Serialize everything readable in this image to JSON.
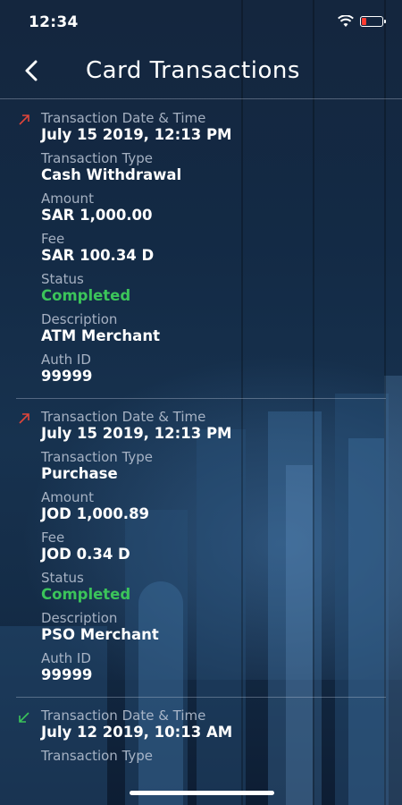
{
  "status": {
    "time": "12:34"
  },
  "header": {
    "title": "Card Transactions"
  },
  "labels": {
    "date": "Transaction Date & Time",
    "type": "Transaction Type",
    "amount": "Amount",
    "fee": "Fee",
    "status": "Status",
    "description": "Description",
    "auth": "Auth ID"
  },
  "transactions": [
    {
      "direction": "outgoing",
      "date": "July 15 2019, 12:13 PM",
      "type": "Cash Withdrawal",
      "amount": "SAR 1,000.00",
      "fee": "SAR 100.34 D",
      "status": "Completed",
      "description": "ATM Merchant",
      "auth": "99999"
    },
    {
      "direction": "outgoing",
      "date": "July 15 2019, 12:13 PM",
      "type": "Purchase",
      "amount": "JOD 1,000.89",
      "fee": "JOD 0.34 D",
      "status": "Completed",
      "description": "PSO Merchant",
      "auth": "99999"
    },
    {
      "direction": "incoming",
      "date": "July 12 2019, 10:13 AM"
    }
  ],
  "colors": {
    "outgoing": "#e0453a",
    "incoming": "#3bc45a",
    "status_completed": "#3bc45a"
  }
}
